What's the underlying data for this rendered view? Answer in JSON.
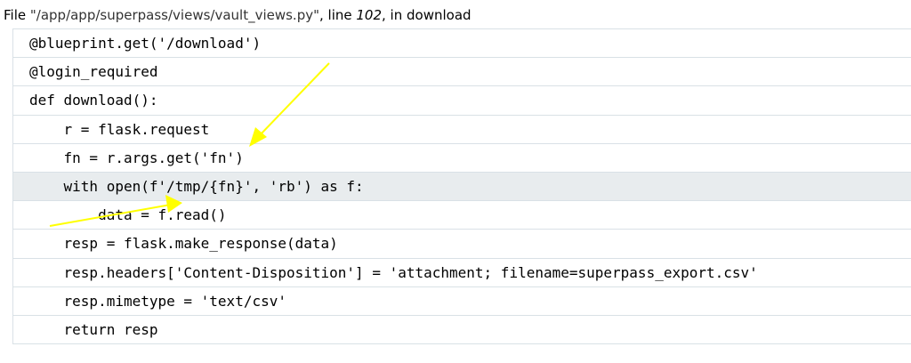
{
  "header": {
    "prefix": "File ",
    "path": "\"/app/app/superpass/views/vault_views.py\"",
    "line_label": ", line ",
    "line_number": "102",
    "in_label": ", in ",
    "function": "download"
  },
  "code_lines": [
    {
      "text": "@blueprint.get('/download')"
    },
    {
      "text": "@login_required"
    },
    {
      "text": "def download():"
    },
    {
      "text": "    r = flask.request"
    },
    {
      "text": "    fn = r.args.get('fn')"
    },
    {
      "text": "    with open(f'/tmp/{fn}', 'rb') as f:"
    },
    {
      "text": "        data = f.read()"
    },
    {
      "text": "    resp = flask.make_response(data)"
    },
    {
      "text": "    resp.headers['Content-Disposition'] = 'attachment; filename=superpass_export.csv'"
    },
    {
      "text": "    resp.mimetype = 'text/csv'"
    },
    {
      "text": "    return resp"
    }
  ],
  "current_line_index": 5,
  "colors": {
    "highlight": "#e8ecee",
    "border": "#d9e1e6",
    "annotation_arrow": "#ffff00"
  }
}
